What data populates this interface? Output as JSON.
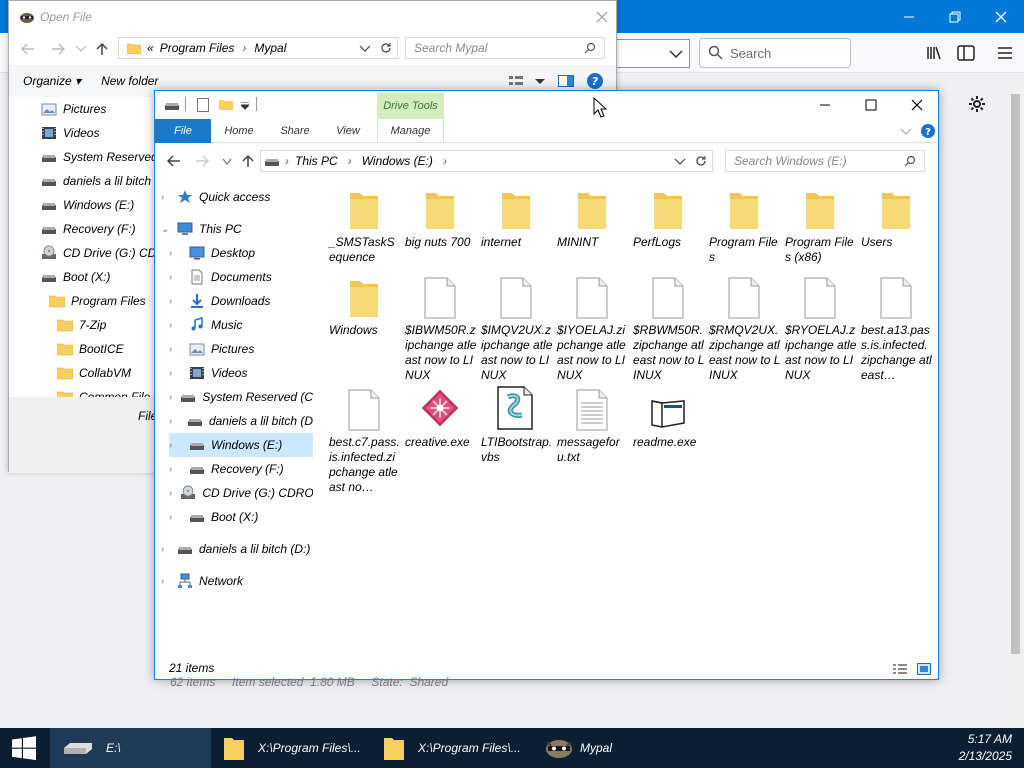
{
  "browser": {
    "search_placeholder": "Search",
    "colors": {
      "titlebar": "#0078d7",
      "toolbar": "#f9f9fb"
    }
  },
  "open_file": {
    "title": "Open File",
    "breadcrumb": [
      "«",
      "Program Files",
      "Mypal"
    ],
    "search_placeholder": "Search Mypal",
    "organize_label": "Organize",
    "new_folder_label": "New folder",
    "tree": [
      {
        "label": "Pictures",
        "icon": "pictures-icon"
      },
      {
        "label": "Videos",
        "icon": "videos-icon"
      },
      {
        "label": "System Reserved",
        "icon": "drive-icon"
      },
      {
        "label": "daniels a lil bitch",
        "icon": "drive-icon"
      },
      {
        "label": "Windows (E:)",
        "icon": "drive-icon"
      },
      {
        "label": "Recovery (F:)",
        "icon": "drive-icon"
      },
      {
        "label": "CD Drive (G:) CD",
        "icon": "cd-icon"
      },
      {
        "label": "Boot (X:)",
        "icon": "drive-icon"
      },
      {
        "label": "Program Files",
        "icon": "folder-icon"
      },
      {
        "label": "7-Zip",
        "icon": "folder-icon"
      },
      {
        "label": "BootICE",
        "icon": "folder-icon"
      },
      {
        "label": "CollabVM",
        "icon": "folder-icon"
      },
      {
        "label": "Common File",
        "icon": "folder-icon"
      }
    ],
    "filename_label": "File"
  },
  "explorer": {
    "drive_tools": "Drive Tools",
    "ribbon_tabs": [
      "File",
      "Home",
      "Share",
      "View",
      "Manage"
    ],
    "address": [
      "This PC",
      "Windows (E:)"
    ],
    "search_placeholder": "Search Windows (E:)",
    "tree": [
      {
        "label": "Quick access",
        "icon": "star-icon",
        "chev": "›",
        "indent": 0
      },
      {
        "label": "This PC",
        "icon": "pc-icon",
        "chev": "⌄",
        "indent": 0
      },
      {
        "label": "Desktop",
        "icon": "desktop-icon",
        "chev": "›",
        "indent": 1
      },
      {
        "label": "Documents",
        "icon": "documents-icon",
        "chev": "›",
        "indent": 1
      },
      {
        "label": "Downloads",
        "icon": "downloads-icon",
        "chev": "›",
        "indent": 1
      },
      {
        "label": "Music",
        "icon": "music-icon",
        "chev": "›",
        "indent": 1
      },
      {
        "label": "Pictures",
        "icon": "pictures-icon",
        "chev": "›",
        "indent": 1
      },
      {
        "label": "Videos",
        "icon": "videos-icon",
        "chev": "›",
        "indent": 1
      },
      {
        "label": "System Reserved (C:",
        "icon": "drive-icon",
        "chev": "›",
        "indent": 1
      },
      {
        "label": "daniels a lil bitch (D",
        "icon": "drive-icon",
        "chev": "›",
        "indent": 1
      },
      {
        "label": "Windows (E:)",
        "icon": "drive-icon",
        "chev": "›",
        "indent": 1,
        "selected": true
      },
      {
        "label": "Recovery (F:)",
        "icon": "drive-icon",
        "chev": "›",
        "indent": 1
      },
      {
        "label": "CD Drive (G:) CDRO",
        "icon": "cd-icon",
        "chev": "›",
        "indent": 1
      },
      {
        "label": "Boot (X:)",
        "icon": "drive-icon",
        "chev": "›",
        "indent": 1
      },
      {
        "label": "daniels a lil bitch (D:)",
        "icon": "drive-icon",
        "chev": "›",
        "indent": 0
      },
      {
        "label": "Network",
        "icon": "network-icon",
        "chev": "›",
        "indent": 0
      }
    ],
    "files": [
      {
        "name": "_SMSTaskSequence",
        "type": "folder"
      },
      {
        "name": "big nuts 700",
        "type": "folder"
      },
      {
        "name": "internet",
        "type": "folder"
      },
      {
        "name": "MININT",
        "type": "folder"
      },
      {
        "name": "PerfLogs",
        "type": "folder"
      },
      {
        "name": "Program Files",
        "type": "folder"
      },
      {
        "name": "Program Files (x86)",
        "type": "folder"
      },
      {
        "name": "Users",
        "type": "folder"
      },
      {
        "name": "Windows",
        "type": "folder"
      },
      {
        "name": "$IBWM50R.zipchange atleast now to LINUX",
        "type": "file"
      },
      {
        "name": "$IMQV2UX.zipchange atleast now to LINUX",
        "type": "file"
      },
      {
        "name": "$IYOELAJ.zipchange atleast now to LINUX",
        "type": "file"
      },
      {
        "name": "$RBWM50R.zipchange atleast now to LINUX",
        "type": "file"
      },
      {
        "name": "$RMQV2UX.zipchange atleast now to LINUX",
        "type": "file"
      },
      {
        "name": "$RYOELAJ.zipchange atleast now to LINUX",
        "type": "file"
      },
      {
        "name": "best.a13.pass.is.infected.zipchange atleast…",
        "type": "file"
      },
      {
        "name": "best.c7.pass.is.infected.zipchange atleast no…",
        "type": "file"
      },
      {
        "name": "creative.exe",
        "type": "creative"
      },
      {
        "name": "LTIBootstrap.vbs",
        "type": "vbs"
      },
      {
        "name": "messageforu.txt",
        "type": "txt"
      },
      {
        "name": "readme.exe",
        "type": "exe"
      }
    ],
    "status": "21 items",
    "behind_status": "62 items     Item selected  1.80 MB     State:  Shared"
  },
  "taskbar": {
    "items": [
      "E:\\",
      "X:\\Program Files\\...",
      "X:\\Program Files\\...",
      "Mypal"
    ],
    "time": "5:17 AM",
    "date": "2/13/2025",
    "color": "#0b1f33"
  }
}
